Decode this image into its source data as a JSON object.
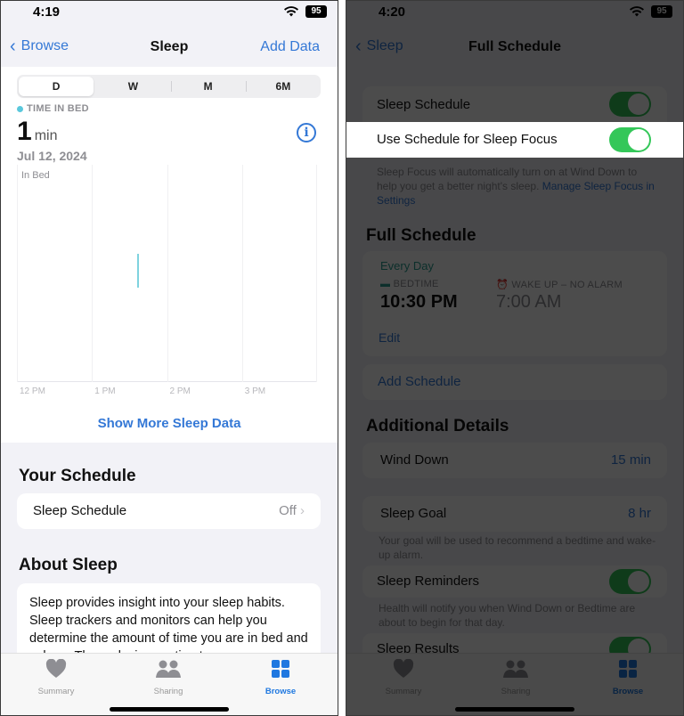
{
  "left": {
    "status": {
      "time": "4:19",
      "battery": "95"
    },
    "nav": {
      "back": "Browse",
      "title": "Sleep",
      "action": "Add Data"
    },
    "segments": [
      "D",
      "W",
      "M",
      "6M"
    ],
    "active_segment": "D",
    "metric": {
      "label": "TIME IN BED",
      "value": "1",
      "unit": "min",
      "date": "Jul 12, 2024",
      "series_color": "#5ac8dc"
    },
    "chart_data": {
      "type": "bar",
      "series_label": "In Bed",
      "x_ticks": [
        "12 PM",
        "1 PM",
        "2 PM",
        "3 PM"
      ],
      "bars": [
        {
          "start": "1:36 PM",
          "duration_min": 1
        }
      ]
    },
    "show_more": "Show More Sleep Data",
    "your_schedule": {
      "heading": "Your Schedule",
      "row_label": "Sleep Schedule",
      "row_value": "Off"
    },
    "about": {
      "heading": "About Sleep",
      "text": "Sleep provides insight into your sleep habits. Sleep trackers and monitors can help you determine the amount of time you are in bed and asleep. These devices estimate"
    },
    "tabs": [
      {
        "label": "Summary",
        "icon": "heart-icon"
      },
      {
        "label": "Sharing",
        "icon": "people-icon"
      },
      {
        "label": "Browse",
        "icon": "grid-icon",
        "active": true
      }
    ]
  },
  "right": {
    "status": {
      "time": "4:20",
      "battery": "95"
    },
    "nav": {
      "back": "Sleep",
      "title": "Full Schedule"
    },
    "sleep_schedule": {
      "label": "Sleep Schedule",
      "on": true
    },
    "sleep_focus": {
      "label": "Use Schedule for Sleep Focus",
      "on": true
    },
    "focus_note": "Sleep Focus will automatically turn on at Wind Down to help you get a better night's sleep.",
    "focus_link": "Manage Sleep Focus in Settings",
    "full_schedule": {
      "heading": "Full Schedule",
      "days": "Every Day",
      "bedtime_label": "BEDTIME",
      "bedtime": "10:30 PM",
      "wake_label": "WAKE UP – NO ALARM",
      "wake": "7:00 AM",
      "edit": "Edit",
      "add": "Add Schedule"
    },
    "additional": {
      "heading": "Additional Details",
      "wind_down_label": "Wind Down",
      "wind_down_value": "15 min",
      "sleep_goal_label": "Sleep Goal",
      "sleep_goal_value": "8 hr",
      "goal_note": "Your goal will be used to recommend a bedtime and wake-up alarm.",
      "reminders_label": "Sleep Reminders",
      "reminders_note": "Health will notify you when Wind Down or Bedtime are about to begin for that day.",
      "results_label": "Sleep Results"
    },
    "tabs": [
      {
        "label": "Summary",
        "icon": "heart-icon"
      },
      {
        "label": "Sharing",
        "icon": "people-icon"
      },
      {
        "label": "Browse",
        "icon": "grid-icon",
        "active": true
      }
    ]
  }
}
